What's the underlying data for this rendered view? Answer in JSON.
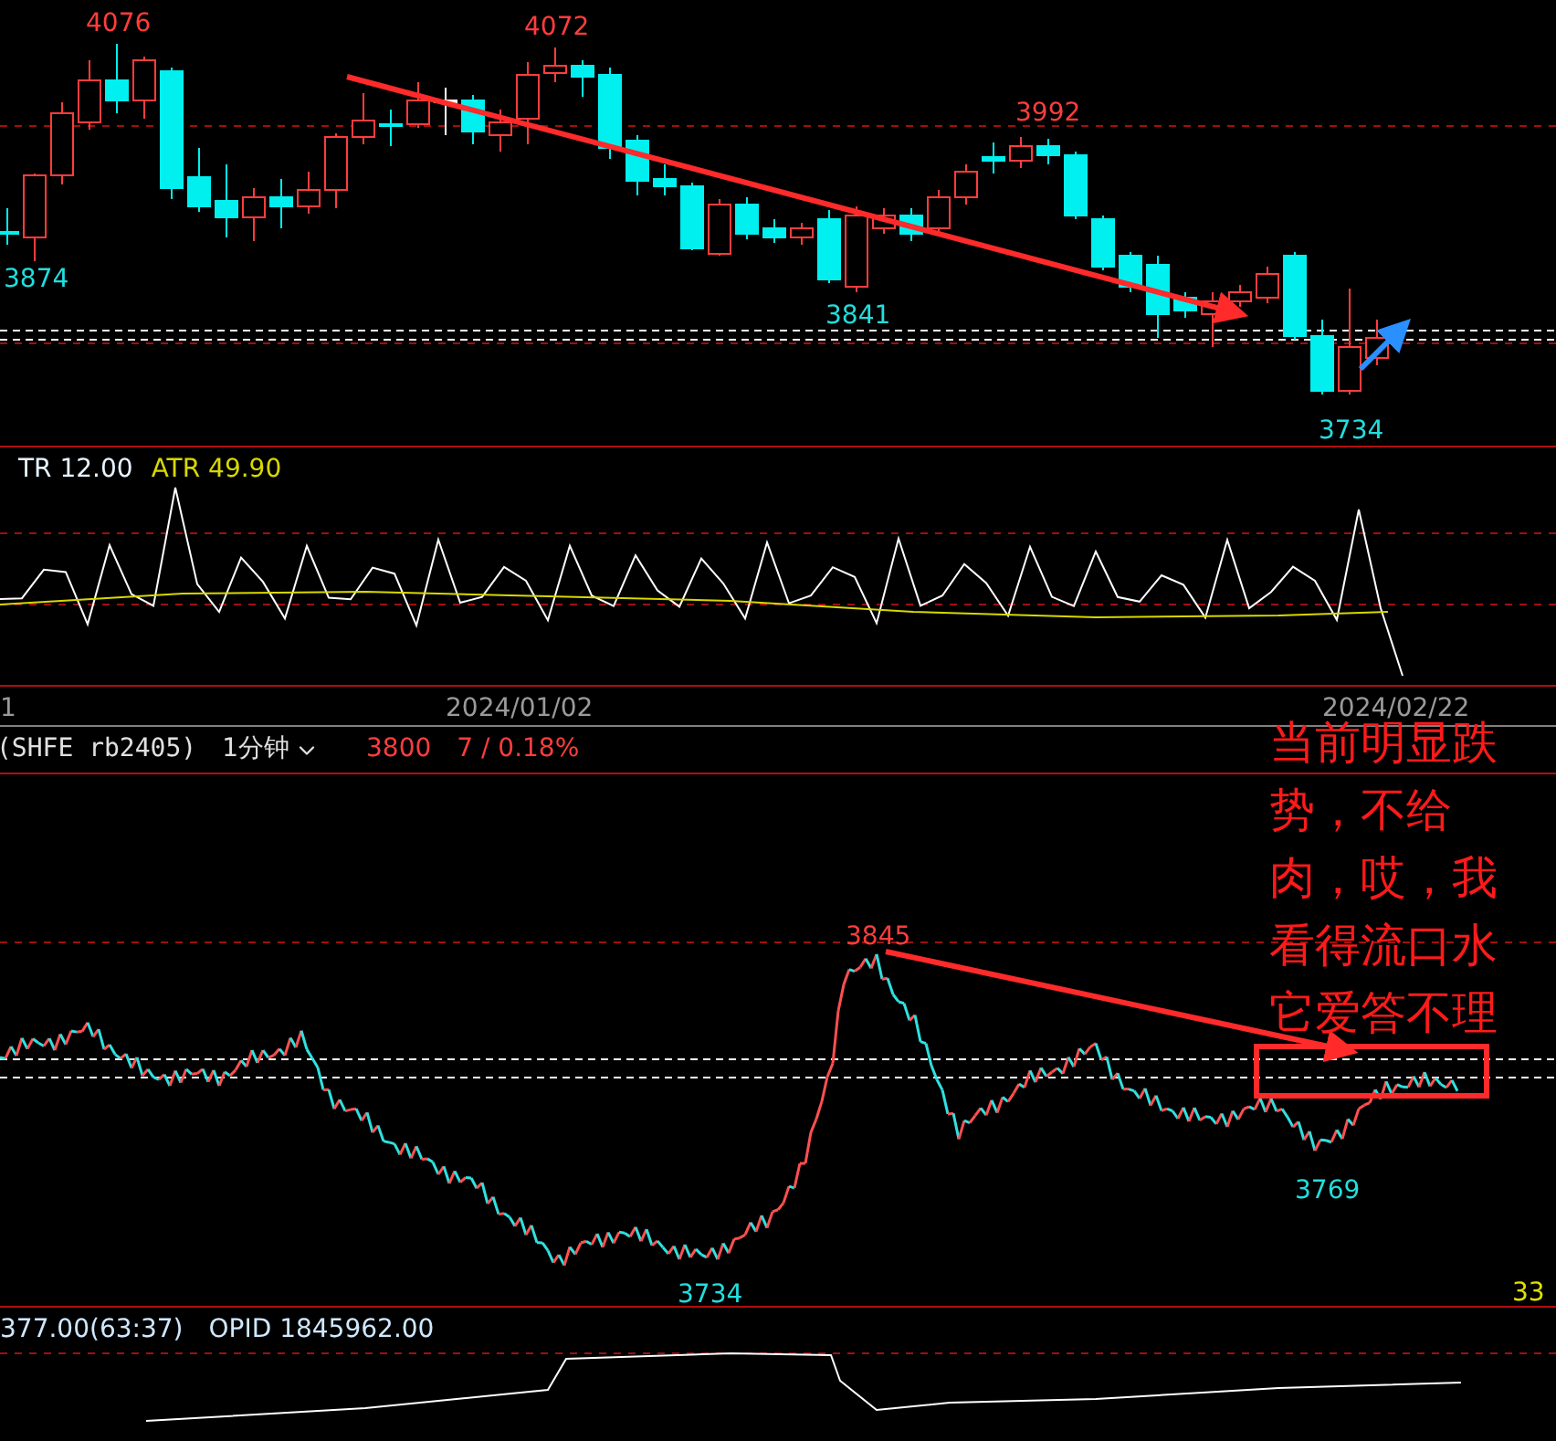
{
  "daily_chart": {
    "price_labels": [
      {
        "text": "4076",
        "kind": "high"
      },
      {
        "text": "4072",
        "kind": "high"
      },
      {
        "text": "3992",
        "kind": "high"
      },
      {
        "text": "3874",
        "kind": "low"
      },
      {
        "text": "3841",
        "kind": "low"
      },
      {
        "text": "3734",
        "kind": "low"
      }
    ]
  },
  "indicator": {
    "tr": "TR 12.00",
    "atr": "ATR 49.90"
  },
  "date_axis": {
    "labels": [
      "1",
      "2024/01/02",
      "2024/02/22"
    ]
  },
  "minute_header": {
    "symbol": "(SHFE rb2405)",
    "period": "1分钟",
    "price": "3800",
    "change": "7 / 0.18%"
  },
  "minute_chart": {
    "price_labels": [
      {
        "text": "3845",
        "kind": "high"
      },
      {
        "text": "3769",
        "kind": "low"
      },
      {
        "text": "3734",
        "kind": "low"
      }
    ],
    "countdown": "33"
  },
  "oi_panel": {
    "oi": "377.00(63:37)",
    "opid": "OPID 1845962.00"
  },
  "annotation": {
    "text": "当前明显跌势，不给肉，哎，我看得流口水它爱答不理"
  }
}
